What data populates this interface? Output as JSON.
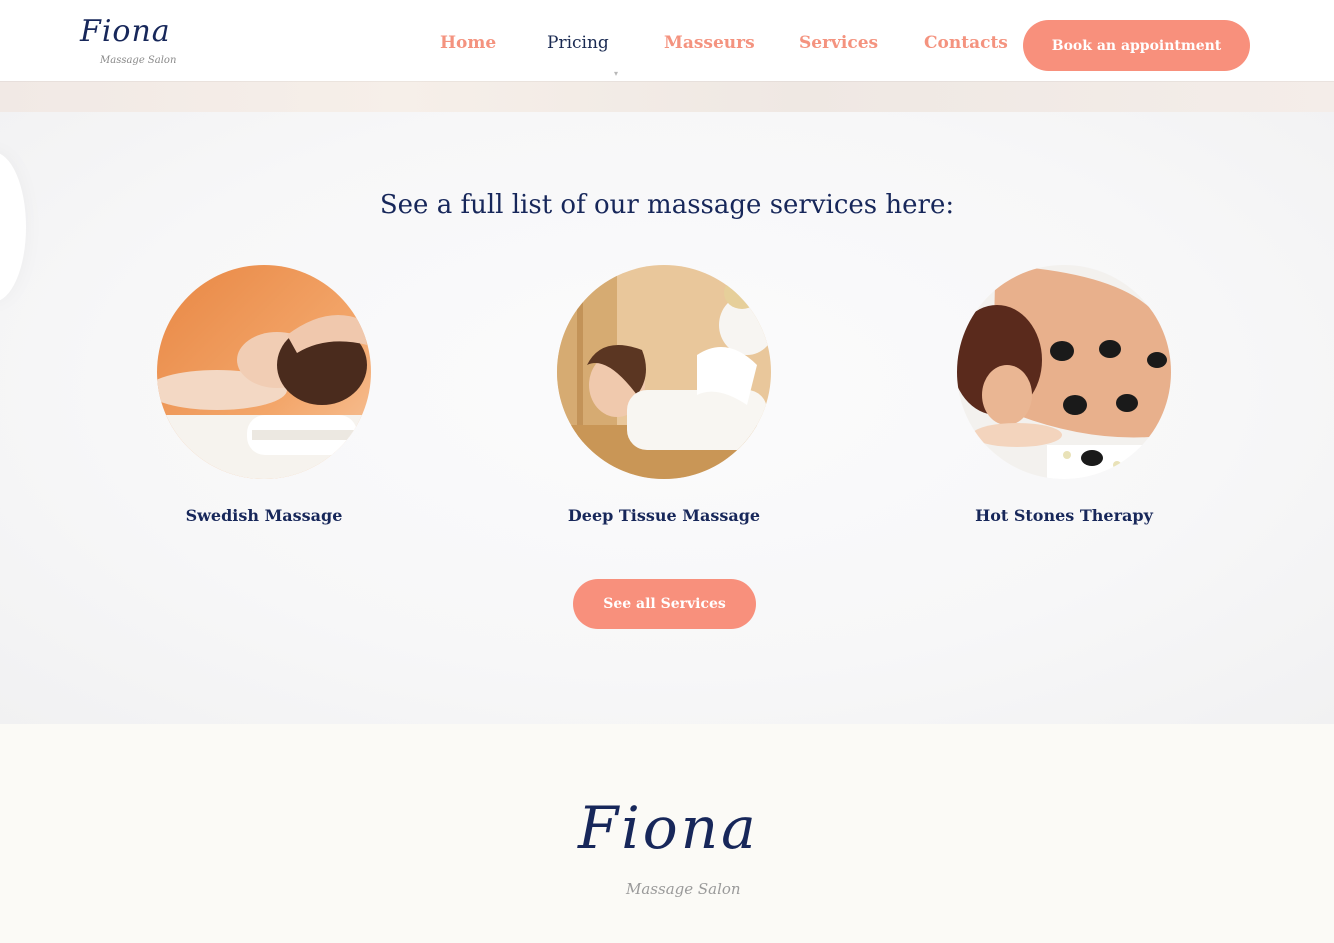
{
  "header": {
    "logo_text": "Fiona",
    "logo_sub": "Massage Salon",
    "nav": [
      "Home",
      "Pricing",
      "Masseurs",
      "Services",
      "Contacts"
    ],
    "book_label": "Book an appointment"
  },
  "services": {
    "title": "See a full list of our massage services here:",
    "items": [
      {
        "name": "Swedish Massage"
      },
      {
        "name": "Deep Tissue Massage"
      },
      {
        "name": "Hot Stones Therapy"
      }
    ],
    "button_label": "See all Services"
  },
  "footer": {
    "logo_text": "Fiona",
    "logo_sub": "Massage Salon"
  },
  "colors": {
    "accent": "#f8907c",
    "navy": "#17275a",
    "footer_bg": "#fbfaf6"
  }
}
